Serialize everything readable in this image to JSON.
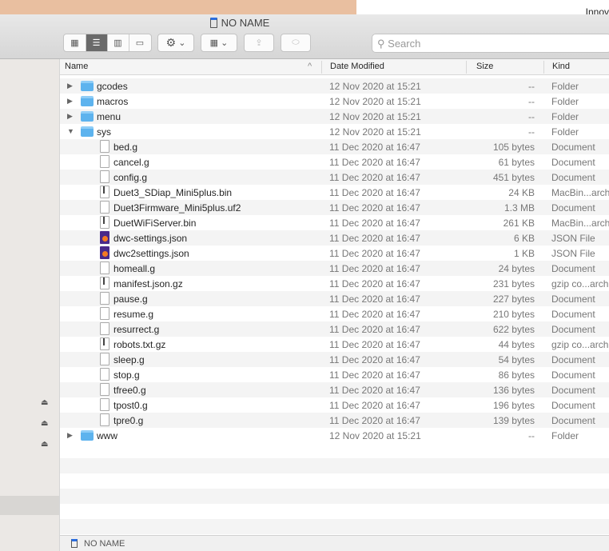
{
  "background_text": "Innov",
  "window": {
    "title": "NO NAME"
  },
  "toolbar": {
    "search_placeholder": "Search",
    "view_modes": [
      "icon",
      "list",
      "column",
      "gallery"
    ],
    "active_view": "list"
  },
  "columns": {
    "name": "Name",
    "date": "Date Modified",
    "size": "Size",
    "kind": "Kind"
  },
  "rows": [
    {
      "name": "gcodes",
      "date": "12 Nov 2020 at 15:21",
      "size": "--",
      "kind": "Folder",
      "type": "folder",
      "indent": 0,
      "disclosure": "collapsed"
    },
    {
      "name": "macros",
      "date": "12 Nov 2020 at 15:21",
      "size": "--",
      "kind": "Folder",
      "type": "folder",
      "indent": 0,
      "disclosure": "collapsed"
    },
    {
      "name": "menu",
      "date": "12 Nov 2020 at 15:21",
      "size": "--",
      "kind": "Folder",
      "type": "folder",
      "indent": 0,
      "disclosure": "collapsed"
    },
    {
      "name": "sys",
      "date": "12 Nov 2020 at 15:21",
      "size": "--",
      "kind": "Folder",
      "type": "folder",
      "indent": 0,
      "disclosure": "expanded"
    },
    {
      "name": "bed.g",
      "date": "11 Dec 2020 at 16:47",
      "size": "105 bytes",
      "kind": "Document",
      "type": "doc",
      "indent": 1
    },
    {
      "name": "cancel.g",
      "date": "11 Dec 2020 at 16:47",
      "size": "61 bytes",
      "kind": "Document",
      "type": "doc",
      "indent": 1
    },
    {
      "name": "config.g",
      "date": "11 Dec 2020 at 16:47",
      "size": "451 bytes",
      "kind": "Document",
      "type": "doc",
      "indent": 1
    },
    {
      "name": "Duet3_SDiap_Mini5plus.bin",
      "date": "11 Dec 2020 at 16:47",
      "size": "24 KB",
      "kind": "MacBin...archive",
      "type": "zip",
      "indent": 1
    },
    {
      "name": "Duet3Firmware_Mini5plus.uf2",
      "date": "11 Dec 2020 at 16:47",
      "size": "1.3 MB",
      "kind": "Document",
      "type": "doc",
      "indent": 1
    },
    {
      "name": "DuetWiFiServer.bin",
      "date": "11 Dec 2020 at 16:47",
      "size": "261 KB",
      "kind": "MacBin...archive",
      "type": "zip",
      "indent": 1
    },
    {
      "name": "dwc-settings.json",
      "date": "11 Dec 2020 at 16:47",
      "size": "6 KB",
      "kind": "JSON File",
      "type": "json",
      "indent": 1
    },
    {
      "name": "dwc2settings.json",
      "date": "11 Dec 2020 at 16:47",
      "size": "1 KB",
      "kind": "JSON File",
      "type": "json",
      "indent": 1
    },
    {
      "name": "homeall.g",
      "date": "11 Dec 2020 at 16:47",
      "size": "24 bytes",
      "kind": "Document",
      "type": "doc",
      "indent": 1
    },
    {
      "name": "manifest.json.gz",
      "date": "11 Dec 2020 at 16:47",
      "size": "231 bytes",
      "kind": "gzip co...archive",
      "type": "zip",
      "indent": 1
    },
    {
      "name": "pause.g",
      "date": "11 Dec 2020 at 16:47",
      "size": "227 bytes",
      "kind": "Document",
      "type": "doc",
      "indent": 1
    },
    {
      "name": "resume.g",
      "date": "11 Dec 2020 at 16:47",
      "size": "210 bytes",
      "kind": "Document",
      "type": "doc",
      "indent": 1
    },
    {
      "name": "resurrect.g",
      "date": "11 Dec 2020 at 16:47",
      "size": "622 bytes",
      "kind": "Document",
      "type": "doc",
      "indent": 1
    },
    {
      "name": "robots.txt.gz",
      "date": "11 Dec 2020 at 16:47",
      "size": "44 bytes",
      "kind": "gzip co...archive",
      "type": "zip",
      "indent": 1
    },
    {
      "name": "sleep.g",
      "date": "11 Dec 2020 at 16:47",
      "size": "54 bytes",
      "kind": "Document",
      "type": "doc",
      "indent": 1
    },
    {
      "name": "stop.g",
      "date": "11 Dec 2020 at 16:47",
      "size": "86 bytes",
      "kind": "Document",
      "type": "doc",
      "indent": 1
    },
    {
      "name": "tfree0.g",
      "date": "11 Dec 2020 at 16:47",
      "size": "136 bytes",
      "kind": "Document",
      "type": "doc",
      "indent": 1
    },
    {
      "name": "tpost0.g",
      "date": "11 Dec 2020 at 16:47",
      "size": "196 bytes",
      "kind": "Document",
      "type": "doc",
      "indent": 1
    },
    {
      "name": "tpre0.g",
      "date": "11 Dec 2020 at 16:47",
      "size": "139 bytes",
      "kind": "Document",
      "type": "doc",
      "indent": 1
    },
    {
      "name": "www",
      "date": "12 Nov 2020 at 15:21",
      "size": "--",
      "kind": "Folder",
      "type": "folder",
      "indent": 0,
      "disclosure": "collapsed"
    }
  ],
  "footer": {
    "path": "NO NAME"
  }
}
